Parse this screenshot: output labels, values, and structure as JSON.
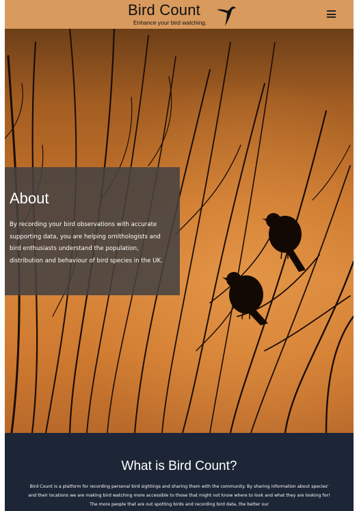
{
  "header": {
    "title": "Bird Count",
    "tagline": "Enhance your bird watching.",
    "logo_icon": "flying-bird-icon",
    "menu_icon": "hamburger-menu-icon",
    "background_color": "#d99a5e"
  },
  "about": {
    "title": "About",
    "text": "By recording your bird observations with accurate supporting data, you are helping ornithologists and bird enthusiasts understand the population, distribution and behaviour of bird species in the UK."
  },
  "hero": {
    "image": "silhouette-birds-on-branches-sunset"
  },
  "what_is": {
    "title": "What is Bird Count?",
    "text": "Bird Count is a platform for recording personal bird sightings and sharing them with the community. By sharing information about species' and their locations we are making bird watching more accessible to those that might not know where to look and what they are looking for! The more people that are out spotting birds and recording bird data, the better our",
    "background_color": "#1d2636"
  }
}
